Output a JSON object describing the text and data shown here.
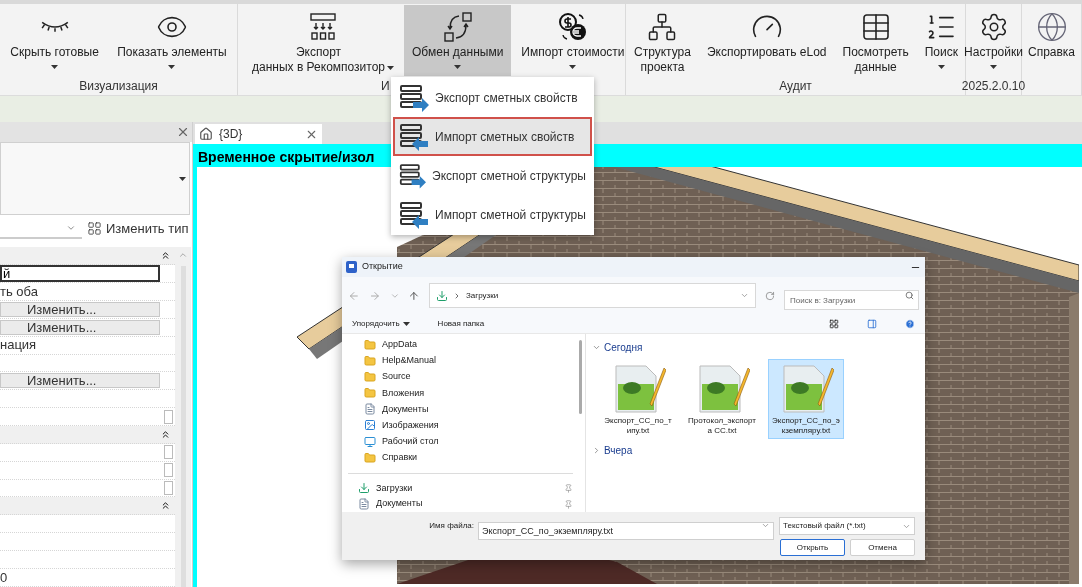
{
  "ribbon": {
    "groups": [
      {
        "label": "Визуализация",
        "buttons": [
          {
            "label": "Скрыть готовые",
            "kind": "dropdown",
            "selected": false
          },
          {
            "label": "Показать элементы",
            "kind": "dropdown",
            "selected": false
          }
        ]
      },
      {
        "label": "И",
        "buttons": [
          {
            "label": "Экспорт\nданных в Рекомпозитор",
            "kind": "split",
            "selected": false
          },
          {
            "label": "Обмен данными",
            "kind": "dropdown",
            "selected": true
          },
          {
            "label": "Импорт стоимости",
            "kind": "dropdown",
            "selected": false
          }
        ]
      },
      {
        "label": "Аудит",
        "buttons": [
          {
            "label": "Структура\nпроекта",
            "kind": "plain",
            "selected": false
          },
          {
            "label": "Экспортировать eLod",
            "kind": "plain",
            "selected": false
          },
          {
            "label": "Посмотреть\nданные",
            "kind": "plain",
            "selected": false
          },
          {
            "label": "Поиск",
            "kind": "dropdown",
            "selected": false
          }
        ]
      },
      {
        "label": "2025.2.0.10",
        "buttons": [
          {
            "label": "Настройки",
            "kind": "dropdown",
            "selected": false
          }
        ]
      },
      {
        "buttons": [
          {
            "label": "Справка",
            "kind": "plain",
            "selected": false
          }
        ]
      }
    ]
  },
  "properties_panel": {
    "edit_type_button": "Изменить тип",
    "rows": [
      {
        "kind": "section",
        "expanded": true
      },
      {
        "kind": "input",
        "value": "й"
      },
      {
        "kind": "text",
        "value": "ть оба"
      },
      {
        "kind": "button",
        "value": "Изменить..."
      },
      {
        "kind": "button",
        "value": "Изменить..."
      },
      {
        "kind": "text",
        "value": "нация"
      },
      {
        "kind": "empty"
      },
      {
        "kind": "button",
        "value": "Изменить..."
      },
      {
        "kind": "empty"
      },
      {
        "kind": "checkbox",
        "checked": false
      },
      {
        "kind": "section",
        "expanded": true
      },
      {
        "kind": "checkbox",
        "checked": false
      },
      {
        "kind": "checkbox",
        "checked": false
      },
      {
        "kind": "checkbox",
        "checked": false
      },
      {
        "kind": "section",
        "expanded": true
      },
      {
        "kind": "empty"
      },
      {
        "kind": "empty"
      },
      {
        "kind": "empty"
      },
      {
        "kind": "text",
        "value": "0"
      }
    ]
  },
  "view": {
    "tab": {
      "label": "{3D}"
    },
    "banner": "Временное скрытие/изол"
  },
  "data_exchange_menu": {
    "items": [
      {
        "label": "Экспорт сметных свойств",
        "kind": "export",
        "selected": false
      },
      {
        "label": "Импорт сметных свойств",
        "kind": "import",
        "selected": true
      },
      {
        "label": "Экспорт сметной структуры",
        "kind": "export",
        "selected": false
      },
      {
        "label": "Импорт сметной структуры",
        "kind": "import",
        "selected": false
      }
    ]
  },
  "open_dialog": {
    "title": "Открытие",
    "address": "Загрузки",
    "search": {
      "placeholder": "Поиск в: Загрузки"
    },
    "organize": "Упорядочить",
    "new_folder": "Новая папка",
    "nav_items": [
      {
        "label": "AppData",
        "kind": "folder",
        "pinned": false
      },
      {
        "label": "Help&Manual",
        "kind": "folder",
        "pinned": false
      },
      {
        "label": "Source",
        "kind": "folder",
        "pinned": false
      },
      {
        "label": "Вложения",
        "kind": "folder",
        "pinned": false
      },
      {
        "label": "Документы",
        "kind": "document",
        "pinned": false
      },
      {
        "label": "Изображения",
        "kind": "images",
        "pinned": false
      },
      {
        "label": "Рабочий стол",
        "kind": "desktop",
        "pinned": false
      },
      {
        "label": "Справки",
        "kind": "folder",
        "pinned": false
      }
    ],
    "quick_access": [
      {
        "label": "Загрузки",
        "kind": "download",
        "pinned": true
      },
      {
        "label": "Документы",
        "kind": "document",
        "pinned": true
      }
    ],
    "groups": [
      {
        "label": "Сегодня",
        "expanded": true,
        "files": [
          {
            "name": "Экспорт_CC_по_типу.txt",
            "selected": false
          },
          {
            "name": "Протокол_экспорта CC.txt",
            "selected": false
          },
          {
            "name": "Экспорт_CC_по_экземпляру.txt",
            "selected": true
          }
        ]
      },
      {
        "label": "Вчера",
        "expanded": false
      }
    ],
    "file_name": {
      "label": "Имя файла:",
      "value": "Экспорт_CC_по_экземпляру.txt"
    },
    "file_type": "Текстовый файл (*.txt)",
    "buttons": [
      {
        "label": "Открыть",
        "kind": "primary"
      },
      {
        "label": "Отмена",
        "kind": "secondary"
      }
    ]
  }
}
